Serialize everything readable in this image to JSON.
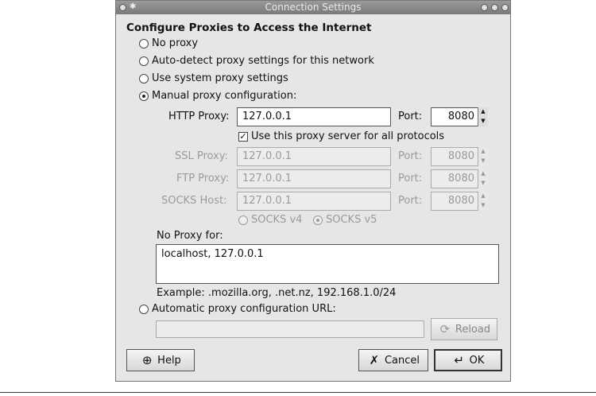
{
  "window": {
    "title": "Connection Settings"
  },
  "heading": "Configure Proxies to Access the Internet",
  "options": {
    "no_proxy": "No proxy",
    "auto_detect": "Auto-detect proxy settings for this network",
    "system": "Use system proxy settings",
    "manual": "Manual proxy configuration:",
    "auto_url": "Automatic proxy configuration URL:"
  },
  "http": {
    "label": "HTTP Proxy:",
    "value": "127.0.0.1",
    "port_label": "Port:",
    "port": "8080"
  },
  "use_all": "Use this proxy server for all protocols",
  "ssl": {
    "label": "SSL Proxy:",
    "value": "127.0.0.1",
    "port_label": "Port:",
    "port": "8080"
  },
  "ftp": {
    "label": "FTP Proxy:",
    "value": "127.0.0.1",
    "port_label": "Port:",
    "port": "8080"
  },
  "socks": {
    "label": "SOCKS Host:",
    "value": "127.0.0.1",
    "port_label": "Port:",
    "port": "8080",
    "v4": "SOCKS v4",
    "v5": "SOCKS v5"
  },
  "no_proxy_for": {
    "label": "No Proxy for:",
    "value": "localhost, 127.0.0.1",
    "example": "Example: .mozilla.org, .net.nz, 192.168.1.0/24"
  },
  "auto_url_value": "",
  "buttons": {
    "reload": "Reload",
    "help": "Help",
    "cancel": "Cancel",
    "ok": "OK"
  },
  "icons": {
    "reload": "reload-icon",
    "help": "lifebuoy-icon",
    "cancel": "x-icon",
    "ok": "enter-arrow-icon"
  }
}
